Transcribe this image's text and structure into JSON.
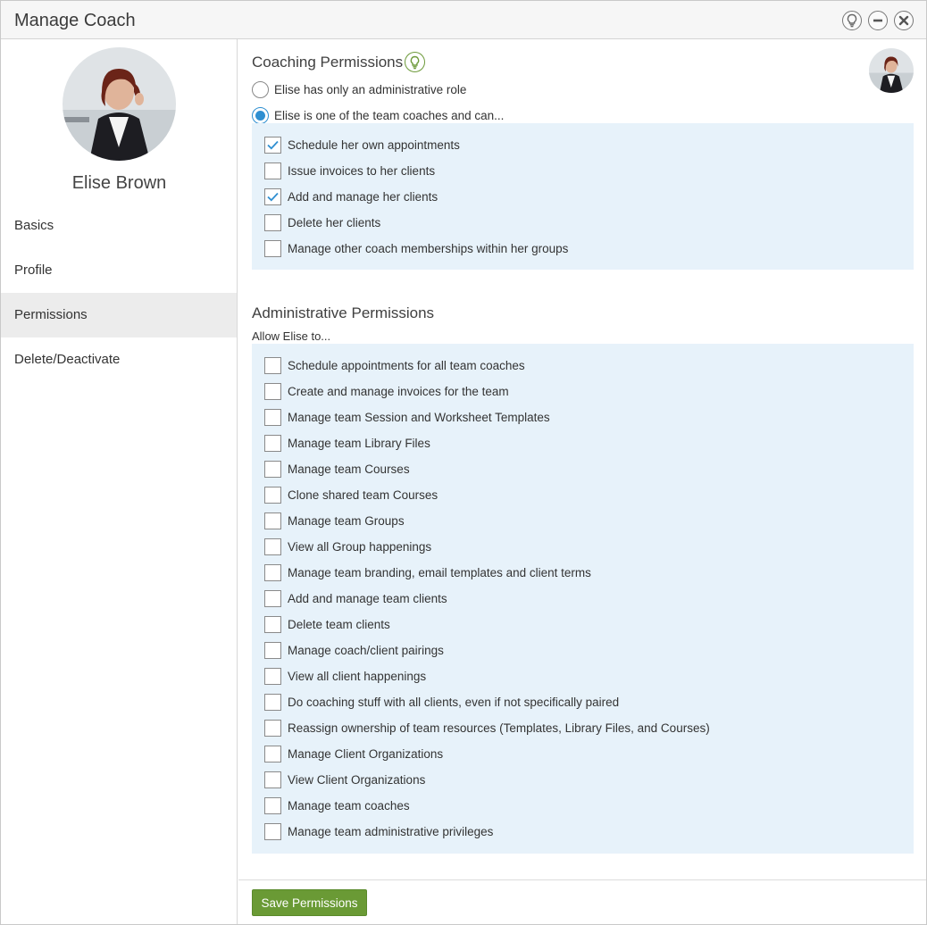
{
  "window": {
    "title": "Manage Coach"
  },
  "window_controls": [
    {
      "name": "help-bulb-button",
      "icon": "lightbulb-icon"
    },
    {
      "name": "minimize-button",
      "icon": "minus-icon"
    },
    {
      "name": "close-button",
      "icon": "close-icon"
    }
  ],
  "sidebar": {
    "coach_name": "Elise Brown",
    "items": [
      {
        "label": "Basics",
        "active": false
      },
      {
        "label": "Profile",
        "active": false
      },
      {
        "label": "Permissions",
        "active": true
      },
      {
        "label": "Delete/Deactivate",
        "active": false
      }
    ]
  },
  "coaching": {
    "title": "Coaching Permissions",
    "role_options": [
      {
        "label": "Elise has only an administrative role",
        "selected": false
      },
      {
        "label": "Elise is one of the team coaches and can...",
        "selected": true
      }
    ],
    "permissions": [
      {
        "label": "Schedule her own appointments",
        "checked": true
      },
      {
        "label": "Issue invoices to her clients",
        "checked": false
      },
      {
        "label": "Add and manage her clients",
        "checked": true
      },
      {
        "label": "Delete her clients",
        "checked": false
      },
      {
        "label": "Manage other coach memberships within her groups",
        "checked": false
      }
    ]
  },
  "administrative": {
    "title": "Administrative Permissions",
    "subtitle": "Allow Elise to...",
    "permissions": [
      {
        "label": "Schedule appointments for all team coaches",
        "checked": false
      },
      {
        "label": "Create and manage invoices for the team",
        "checked": false
      },
      {
        "label": "Manage team Session and Worksheet Templates",
        "checked": false
      },
      {
        "label": "Manage team Library Files",
        "checked": false
      },
      {
        "label": "Manage team Courses",
        "checked": false
      },
      {
        "label": "Clone shared team Courses",
        "checked": false
      },
      {
        "label": "Manage team Groups",
        "checked": false
      },
      {
        "label": "View all Group happenings",
        "checked": false
      },
      {
        "label": "Manage team branding, email templates and client terms",
        "checked": false
      },
      {
        "label": "Add and manage team clients",
        "checked": false
      },
      {
        "label": "Delete team clients",
        "checked": false
      },
      {
        "label": "Manage coach/client pairings",
        "checked": false
      },
      {
        "label": "View all client happenings",
        "checked": false
      },
      {
        "label": "Do coaching stuff with all clients, even if not specifically paired",
        "checked": false
      },
      {
        "label": "Reassign ownership of team resources (Templates, Library Files, and Courses)",
        "checked": false
      },
      {
        "label": "Manage Client Organizations",
        "checked": false
      },
      {
        "label": "View Client Organizations",
        "checked": false
      },
      {
        "label": "Manage team coaches",
        "checked": false
      },
      {
        "label": "Manage team administrative privileges",
        "checked": false
      }
    ]
  },
  "footer": {
    "save_label": "Save Permissions"
  },
  "colors": {
    "accent_green": "#6a9a35",
    "radio_blue": "#2f8fd1",
    "panel_bg": "#e7f2fa",
    "active_nav_bg": "#ececec",
    "check_color": "#2f8fd1"
  }
}
